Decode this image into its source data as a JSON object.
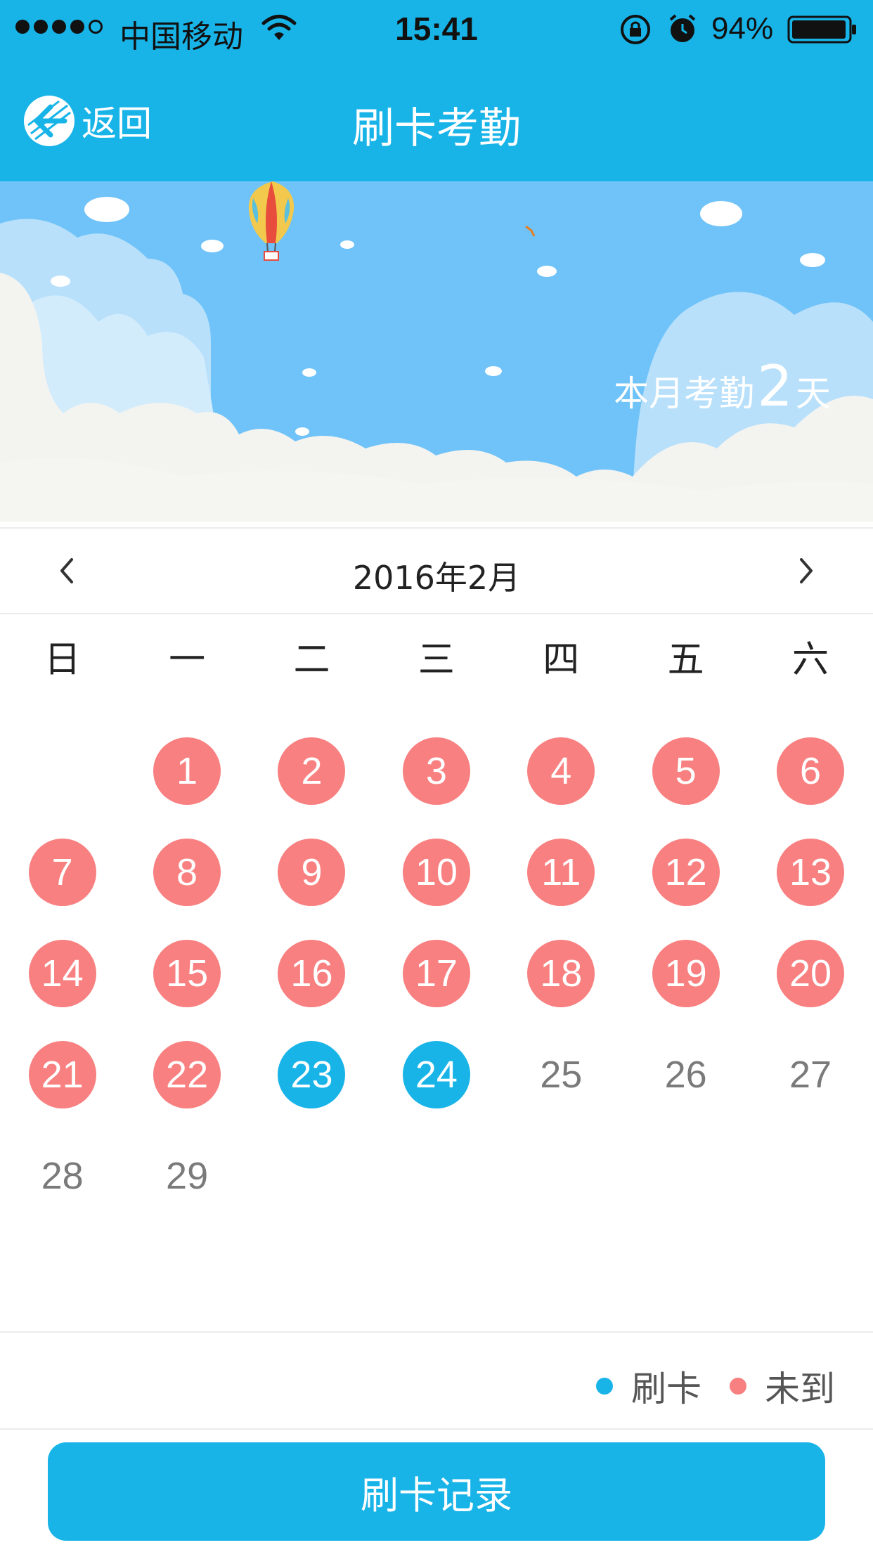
{
  "status_bar": {
    "carrier": "中国移动",
    "time": "15:41",
    "battery": "94%"
  },
  "nav": {
    "back_label": "返回",
    "title": "刷卡考勤"
  },
  "banner": {
    "prefix": "本月考勤",
    "count": "2",
    "suffix": "天"
  },
  "calendar": {
    "month_label": "2016年2月",
    "weekdays": [
      "日",
      "一",
      "二",
      "三",
      "四",
      "五",
      "六"
    ],
    "weeks": [
      [
        {
          "day": "",
          "status": "none"
        },
        {
          "day": "1",
          "status": "absent"
        },
        {
          "day": "2",
          "status": "absent"
        },
        {
          "day": "3",
          "status": "absent"
        },
        {
          "day": "4",
          "status": "absent"
        },
        {
          "day": "5",
          "status": "absent"
        },
        {
          "day": "6",
          "status": "absent"
        }
      ],
      [
        {
          "day": "7",
          "status": "absent"
        },
        {
          "day": "8",
          "status": "absent"
        },
        {
          "day": "9",
          "status": "absent"
        },
        {
          "day": "10",
          "status": "absent"
        },
        {
          "day": "11",
          "status": "absent"
        },
        {
          "day": "12",
          "status": "absent"
        },
        {
          "day": "13",
          "status": "absent"
        }
      ],
      [
        {
          "day": "14",
          "status": "absent"
        },
        {
          "day": "15",
          "status": "absent"
        },
        {
          "day": "16",
          "status": "absent"
        },
        {
          "day": "17",
          "status": "absent"
        },
        {
          "day": "18",
          "status": "absent"
        },
        {
          "day": "19",
          "status": "absent"
        },
        {
          "day": "20",
          "status": "absent"
        }
      ],
      [
        {
          "day": "21",
          "status": "absent"
        },
        {
          "day": "22",
          "status": "absent"
        },
        {
          "day": "23",
          "status": "punched"
        },
        {
          "day": "24",
          "status": "punched"
        },
        {
          "day": "25",
          "status": "plain"
        },
        {
          "day": "26",
          "status": "plain"
        },
        {
          "day": "27",
          "status": "plain"
        }
      ],
      [
        {
          "day": "28",
          "status": "plain"
        },
        {
          "day": "29",
          "status": "plain"
        },
        {
          "day": "",
          "status": "none"
        },
        {
          "day": "",
          "status": "none"
        },
        {
          "day": "",
          "status": "none"
        },
        {
          "day": "",
          "status": "none"
        },
        {
          "day": "",
          "status": "none"
        }
      ]
    ]
  },
  "legend": {
    "punched_label": "刷卡",
    "absent_label": "未到"
  },
  "record_button": "刷卡记录",
  "colors": {
    "primary": "#18b4e8",
    "absent": "#f88080"
  },
  "icons": [
    "back-icon",
    "prev-month-icon",
    "next-month-icon",
    "wifi-icon",
    "alarm-icon",
    "battery-icon"
  ]
}
